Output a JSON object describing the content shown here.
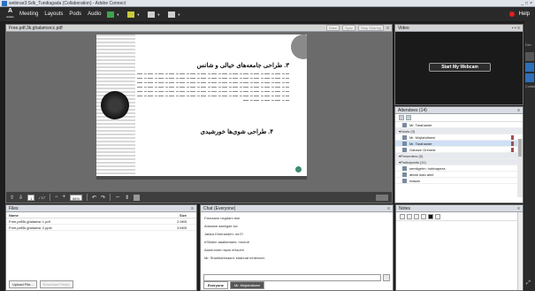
{
  "window": {
    "title": "webinar3:Sdk_Tundiagada (Collaboration) - Adobe Connect",
    "controls": [
      "_",
      "□",
      "×"
    ]
  },
  "menubar": {
    "logo_text": "A",
    "logo_sub": "Adobe",
    "items": [
      "Meeting",
      "Layouts",
      "Pods",
      "Audio"
    ],
    "help": "Help"
  },
  "share": {
    "title": "Free.pdf.3k.ghalamsrcc.pdf",
    "buttons": [
      "Draw",
      "Sync",
      "Stop Sharing"
    ],
    "doc": {
      "heading1": "۳. طراحی جامعه‌های خیالی و شانس",
      "heading2": "۴. طراحی شوی‌ها خورشیدی"
    },
    "bar": {
      "page": "1",
      "total": "/ 17",
      "zoom": "56%"
    }
  },
  "video": {
    "title": "Video",
    "start_label": "Start My Webcam"
  },
  "attendees": {
    "title": "Attendees (14)",
    "rows": [
      {
        "text": "Mr. Tarahande",
        "type": "item",
        "selected": false
      },
      {
        "text": "Hosts (3)",
        "type": "group",
        "selected": false
      },
      {
        "text": "Mr. Mojtahdiseni",
        "type": "item",
        "selected": false
      },
      {
        "text": "Mr. Tarahande",
        "type": "item",
        "selected": true
      },
      {
        "text": "Gabaze Grenest",
        "type": "item",
        "selected": false
      },
      {
        "text": "Presenters (0)",
        "type": "group",
        "selected": false
      },
      {
        "text": "Participants (11)",
        "type": "group",
        "selected": false
      },
      {
        "text": "semtigehn: hobbapeza",
        "type": "item",
        "selected": false
      },
      {
        "text": "afeah dalu ahel",
        "type": "item",
        "selected": false
      },
      {
        "text": "masan",
        "type": "item",
        "selected": false
      }
    ]
  },
  "files": {
    "title": "Files",
    "col_name": "Name",
    "col_size": "Size",
    "rows": [
      {
        "name": "Free.pdf3k.ghalamsr 1.pdf",
        "size": "2.9KB"
      },
      {
        "name": "Free.pdf3k.ghalamsr 2.pptx",
        "size": "3.6KB"
      }
    ],
    "upload_label": "Upload File...",
    "download_label": "Download File(s)"
  },
  "chat": {
    "title": "Chat (Everyone)",
    "messages": [
      "Farnaane negdam bse",
      "Ardaane saebgde.lov",
      "Jafara Kheirandeh: mnTl",
      "eShlaim aaaltamaes: mrutuit",
      "Aaneunnet niwar nHaoHr",
      "Mr. Shahbahmaani: kdahnat mhlerzcm"
    ],
    "tabs": [
      "Everyone",
      "Mr. Mojtahdiseni"
    ]
  },
  "notes": {
    "title": "Notes"
  },
  "rightedge": {
    "label": "Dev",
    "label2": "Collabo"
  },
  "colors": {
    "menubar": "#2a2a2a",
    "podhead": "#d9dde3",
    "accent": "#2d6fb8",
    "record": "#e02020"
  }
}
